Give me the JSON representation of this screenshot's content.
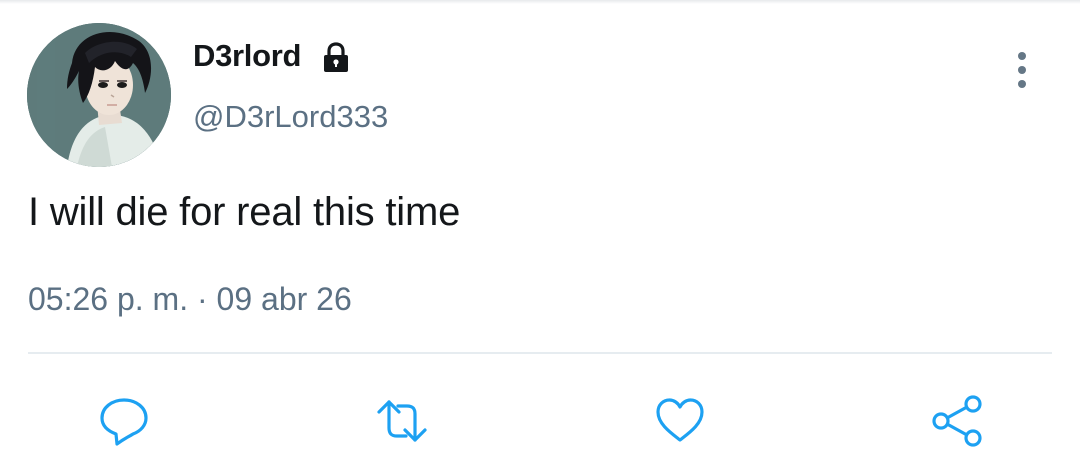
{
  "tweet": {
    "display_name": "D3rlord",
    "handle": "@D3rLord333",
    "text": "I will die for real this time",
    "timestamp": "05:26 p. m. · 09 abr 26",
    "protected_icon": "lock-icon"
  },
  "menu": {
    "icon": "more-vertical-icon"
  },
  "actions": [
    {
      "name": "reply",
      "icon": "reply-icon"
    },
    {
      "name": "retweet",
      "icon": "retweet-icon"
    },
    {
      "name": "like",
      "icon": "heart-icon"
    },
    {
      "name": "share",
      "icon": "share-icon"
    }
  ],
  "colors": {
    "primary_text": "#14171a",
    "secondary_text": "#5b7083",
    "icon": "#1da1f2",
    "divider": "#e6ecf0"
  }
}
